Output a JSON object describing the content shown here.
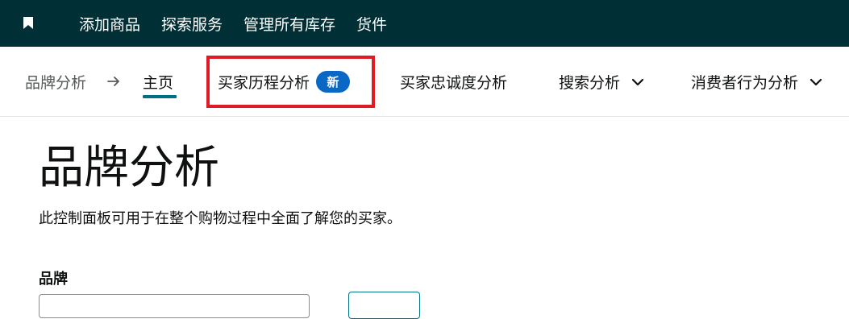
{
  "topbar": {
    "icon": "bookmark-icon",
    "items": [
      "添加商品",
      "探索服务",
      "管理所有库存",
      "货件"
    ]
  },
  "subnav": {
    "breadcrumb_root": "品牌分析",
    "arrow_icon": "arrow-right-icon",
    "tabs": {
      "home": "主页",
      "journey": "买家历程分析",
      "journey_badge": "新",
      "loyalty": "买家忠诚度分析",
      "search": "搜索分析",
      "consumer": "消费者行为分析"
    },
    "highlight_color": "#e01b24",
    "accent_color": "#007185",
    "badge_color": "#0968c6"
  },
  "main": {
    "title": "品牌分析",
    "description": "此控制面板可用于在整个购物过程中全面了解您的买家。",
    "brand_label": "品牌"
  },
  "colors": {
    "topbar_bg": "#002f36"
  }
}
